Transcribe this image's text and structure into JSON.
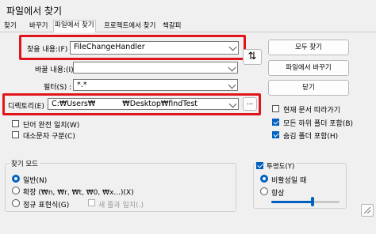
{
  "window": {
    "title": "파일에서 찾기"
  },
  "tabs": [
    "찾기",
    "바꾸기",
    "파일에서 찾기",
    "프로젝트에서 찾기",
    "책갈피"
  ],
  "fields": {
    "find_label": "찾을 내용:(F)",
    "find_value": "FileChangeHandler",
    "replace_label": "바꿀 내용:(I)",
    "replace_value": "",
    "filter_label": "필터(S) :",
    "filter_value": "*.*",
    "dir_label": "디렉토리(E) :",
    "dir_value": "C:₩Users₩",
    "dir_value_tail": "₩Desktop₩findTest",
    "browse_label": "..."
  },
  "buttons": {
    "find_all": "모두 찾기",
    "replace_in_files": "파일에서 바꾸기",
    "close": "닫기",
    "swap": "⇅"
  },
  "options_left": [
    {
      "label": "단어 완전 일치(W)",
      "checked": false
    },
    {
      "label": "대소문자 구분(C)",
      "checked": false
    }
  ],
  "options_right": [
    {
      "label": "현재 문서 따라가기",
      "checked": false
    },
    {
      "label": "모든 하위 폴더 포함(B)",
      "checked": true
    },
    {
      "label": "숨김 폴더 포함(H)",
      "checked": true
    }
  ],
  "search_mode": {
    "title": "찾기 모드",
    "options": [
      {
        "label": "일반(N)",
        "selected": true
      },
      {
        "label": "확장 (₩n, ₩r, ₩t, ₩0, ₩x...)(X)",
        "selected": false
      },
      {
        "label": "정규 표현식(G)",
        "selected": false
      }
    ],
    "dot_newline_label": "새 줄과 일치(.)"
  },
  "transparency": {
    "title": "투명도(Y)",
    "checked": true,
    "options": [
      {
        "label": "비활성일 때",
        "selected": true
      },
      {
        "label": "항상",
        "selected": false
      }
    ],
    "slider_level": 0.6
  },
  "colors": {
    "highlight": "#e0151c",
    "accent": "#0060c0"
  }
}
